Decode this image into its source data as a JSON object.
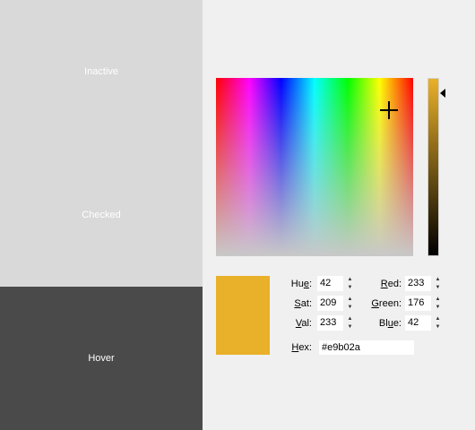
{
  "sidebar": {
    "items": [
      {
        "label": "Inactive"
      },
      {
        "label": "Checked"
      },
      {
        "label": "Hover"
      }
    ]
  },
  "color": {
    "swatch": "#e9b02a"
  },
  "fields": {
    "hue": {
      "label_pre": "Hu",
      "label_key": "e",
      "label_post": ":",
      "value": "42"
    },
    "sat": {
      "label_pre": "",
      "label_key": "S",
      "label_post": "at:",
      "value": "209"
    },
    "val": {
      "label_pre": "",
      "label_key": "V",
      "label_post": "al:",
      "value": "233"
    },
    "red": {
      "label_pre": "",
      "label_key": "R",
      "label_post": "ed:",
      "value": "233"
    },
    "green": {
      "label_pre": "",
      "label_key": "G",
      "label_post": "reen:",
      "value": "176"
    },
    "blue": {
      "label_pre": "Bl",
      "label_key": "u",
      "label_post": "e:",
      "value": "42"
    },
    "hex": {
      "label_pre": "",
      "label_key": "H",
      "label_post": "ex:",
      "value": "#e9b02a"
    }
  },
  "icons": {
    "spin_up": "▲",
    "spin_down": "▼"
  }
}
